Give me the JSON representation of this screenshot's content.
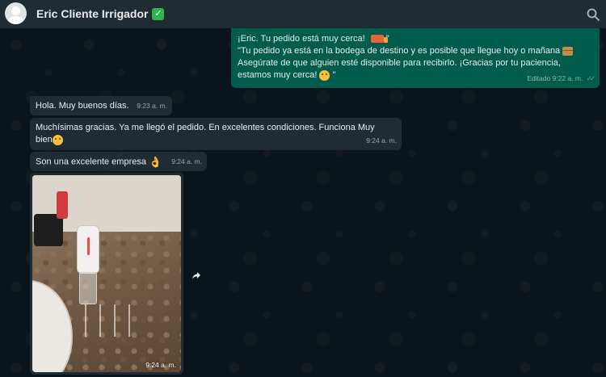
{
  "header": {
    "contact_name": "Eric Cliente Irrigador",
    "icons": {
      "verified": "check-mark-button-emoji",
      "search": "search-icon",
      "avatar": "default-avatar"
    }
  },
  "messages": [
    {
      "direction": "outgoing",
      "lines": [
        "¡Eric. Tu pedido está muy cerca!",
        "\"Tu pedido ya está en la bodega de destino y es posible que llegue hoy o mañana",
        "Asegúrate de que alguien esté disponible para recibirlo. ¡Gracias por tu paciencia,",
        "estamos muy cerca!"
      ],
      "quote_close_1": "\"",
      "quote_close_2": "\"",
      "meta": "Editado 9:22 a. m.",
      "status": "read-double-check"
    },
    {
      "direction": "incoming",
      "text": "Hola. Muy buenos días.",
      "time": "9:23 a. m."
    },
    {
      "direction": "incoming",
      "text": "Muchísimas gracias. Ya me llegó el pedido. En excelentes condiciones. Funciona Muy",
      "text2": "bien",
      "time": "9:24 a. m."
    },
    {
      "direction": "incoming",
      "text": "Son una excelente empresa",
      "time": "9:24 a. m."
    },
    {
      "direction": "incoming",
      "type": "image",
      "time": "9:24 a. m.",
      "image_content": "oral irrigator on bathroom counter"
    }
  ],
  "colors": {
    "chat_bg": "#0b141a",
    "header_bg": "#202c33",
    "outgoing_bubble": "#005c4b",
    "incoming_bubble": "#202c33"
  }
}
